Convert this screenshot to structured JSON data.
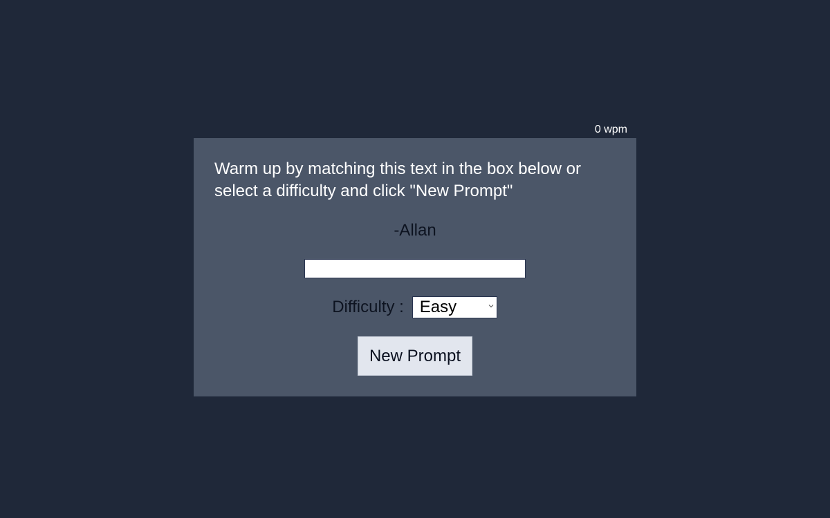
{
  "stats": {
    "wpm": "0 wpm"
  },
  "prompt": {
    "text": "Warm up by matching this text in the box below or select a difficulty and click \"New Prompt\"",
    "author": "-Allan"
  },
  "typing": {
    "value": "",
    "placeholder": ""
  },
  "difficulty": {
    "label": "Difficulty :",
    "selected": "Easy"
  },
  "actions": {
    "new_prompt_label": "New Prompt"
  },
  "colors": {
    "background": "#1f2839",
    "card": "#4b5668",
    "button": "#e2e6ee"
  }
}
